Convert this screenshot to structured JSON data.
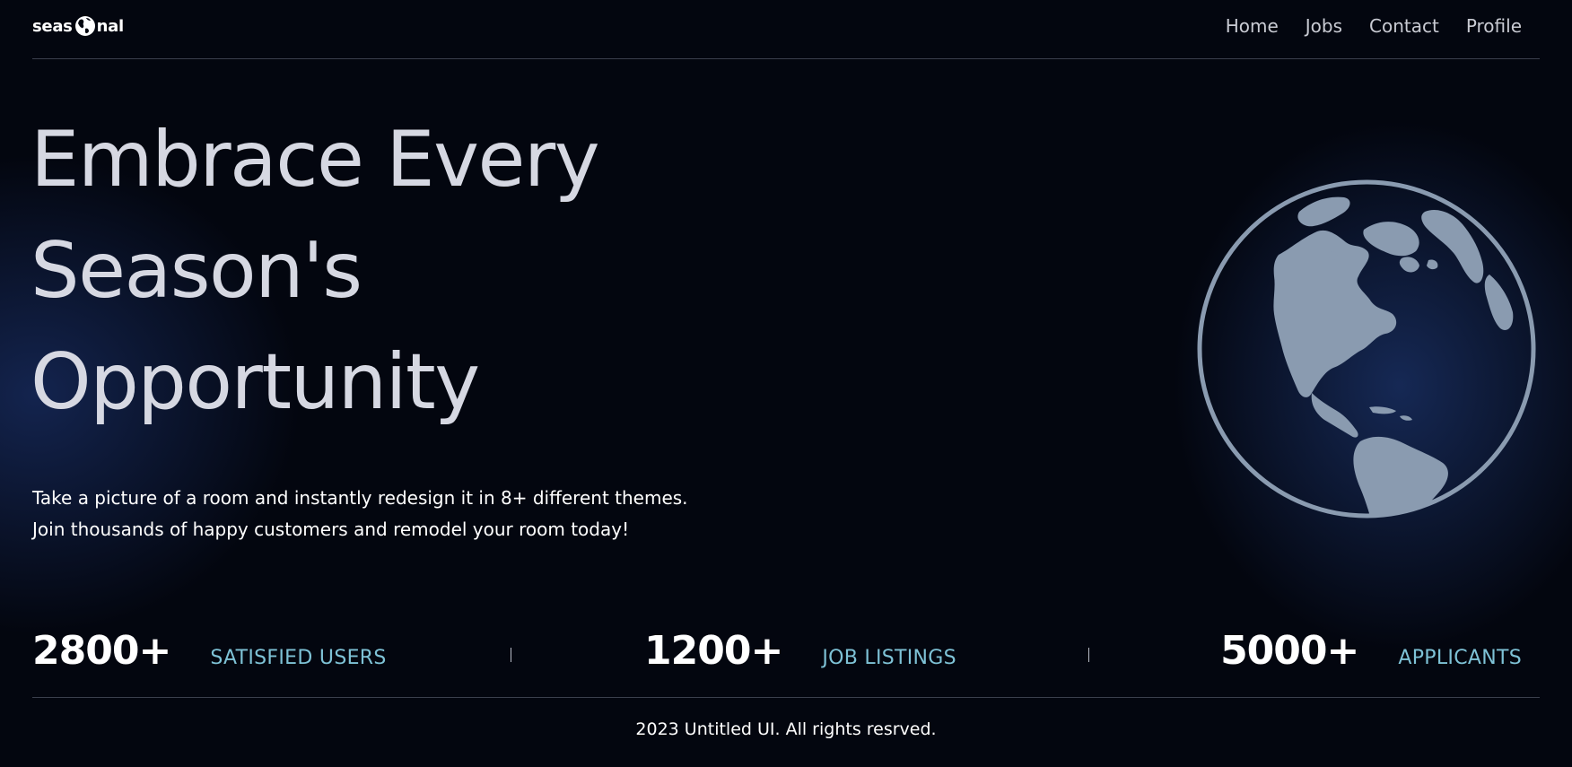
{
  "header": {
    "logo_left": "seas",
    "logo_right": "nal",
    "logo_icon": "globe-icon",
    "nav": [
      {
        "label": "Home"
      },
      {
        "label": "Jobs"
      },
      {
        "label": "Contact"
      },
      {
        "label": "Profile"
      }
    ]
  },
  "hero": {
    "title_lines": [
      "Embrace Every",
      "Season's",
      "Opportunity"
    ],
    "description_lines": [
      "Take a picture of a room and instantly redesign it in 8+ different themes.",
      "Join thousands of happy customers and remodel your room today!"
    ],
    "illustration": "globe-americas-icon"
  },
  "stats": [
    {
      "value": "2800+",
      "label": "SATISFIED USERS"
    },
    {
      "value": "1200+",
      "label": "JOB LISTINGS"
    },
    {
      "value": "5000+",
      "label": "APPLICANTS"
    }
  ],
  "footer": {
    "copyright": "2023 Untitled UI. All rights resrved."
  },
  "colors": {
    "background": "#03060f",
    "title": "#d6d8e2",
    "stat_label": "#7ec2d6",
    "globe": "#8a9bb0",
    "glow": "#1c346c"
  }
}
